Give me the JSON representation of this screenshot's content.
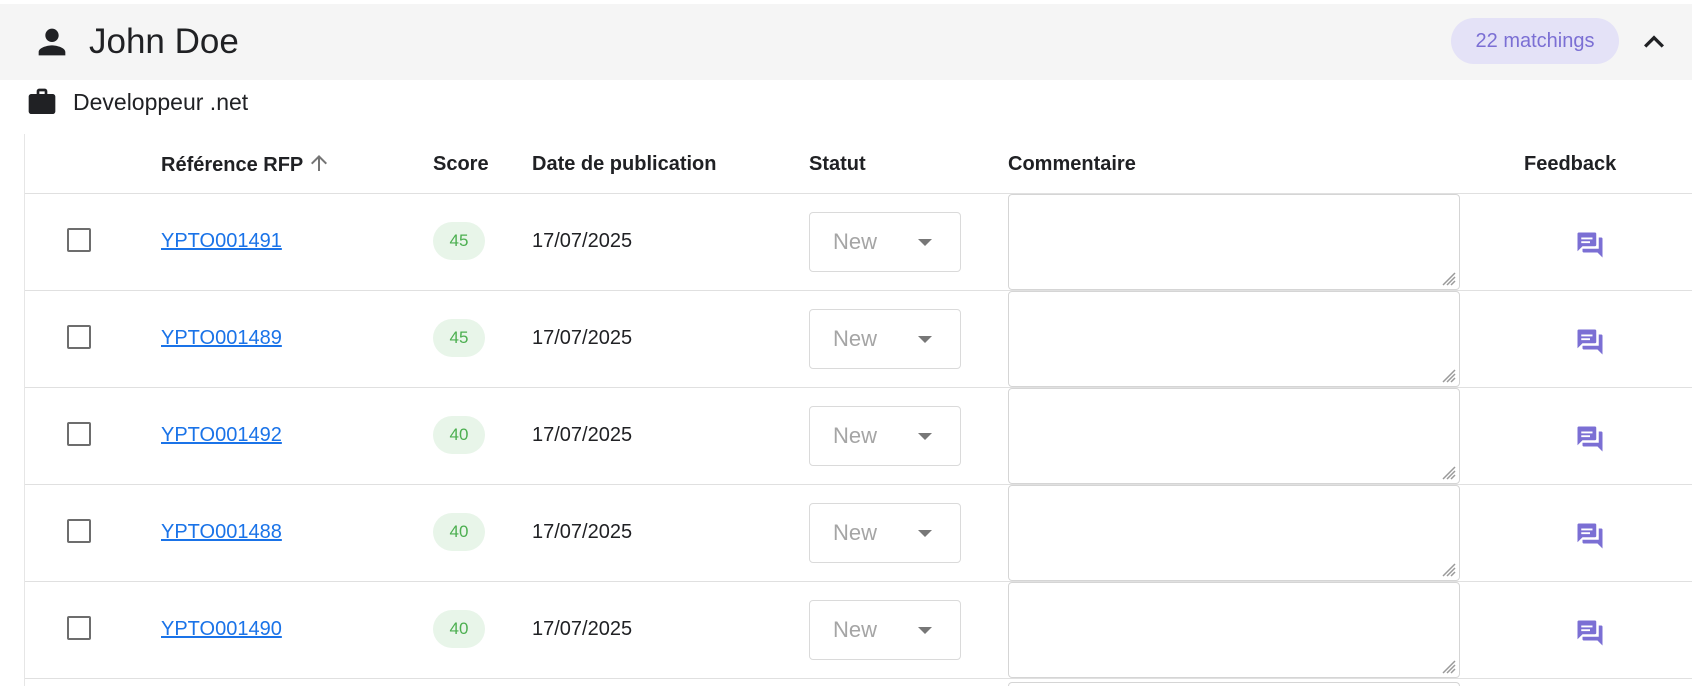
{
  "panel": {
    "name": "John Doe",
    "matchings": "22 matchings"
  },
  "job": {
    "title": "Developpeur .net"
  },
  "table": {
    "headers": {
      "reference": "Référence RFP",
      "score": "Score",
      "date": "Date de publication",
      "status": "Statut",
      "comment": "Commentaire",
      "feedback": "Feedback"
    },
    "rows": [
      {
        "reference": "YPTO001491",
        "score": "45",
        "date": "17/07/2025",
        "status": "New",
        "comment": ""
      },
      {
        "reference": "YPTO001489",
        "score": "45",
        "date": "17/07/2025",
        "status": "New",
        "comment": ""
      },
      {
        "reference": "YPTO001492",
        "score": "40",
        "date": "17/07/2025",
        "status": "New",
        "comment": ""
      },
      {
        "reference": "YPTO001488",
        "score": "40",
        "date": "17/07/2025",
        "status": "New",
        "comment": ""
      },
      {
        "reference": "YPTO001490",
        "score": "40",
        "date": "17/07/2025",
        "status": "New",
        "comment": ""
      }
    ]
  },
  "icons": {
    "person": "person-icon",
    "collapse": "chevron-up-icon",
    "job": "briefcase-icon",
    "sort": "arrow-up-icon",
    "feedback": "feedback-chat-icon"
  },
  "colors": {
    "header_bg": "#f5f5f5",
    "badge_bg": "#e4e2f7",
    "badge_text": "#7b6fd4",
    "link": "#1a73e8",
    "score_bg": "#e8f5e9",
    "score_text": "#4caf50",
    "feedback_icon": "#7b6fd4"
  }
}
